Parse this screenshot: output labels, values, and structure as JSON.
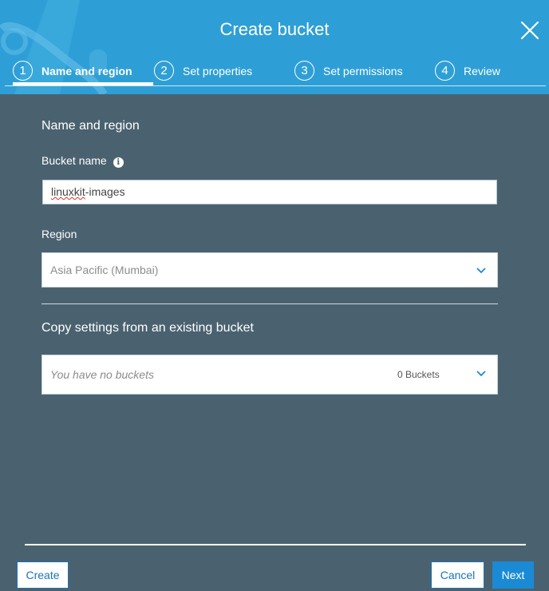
{
  "dialog": {
    "title": "Create bucket"
  },
  "steps": [
    {
      "number": "1",
      "label": "Name and region",
      "active": true
    },
    {
      "number": "2",
      "label": "Set properties",
      "active": false
    },
    {
      "number": "3",
      "label": "Set permissions",
      "active": false
    },
    {
      "number": "4",
      "label": "Review",
      "active": false
    }
  ],
  "form": {
    "section_title": "Name and region",
    "bucket_name_label": "Bucket name",
    "bucket_name_value_misspelled": "linuxkit",
    "bucket_name_value_rest": "-images",
    "region_label": "Region",
    "region_value": "Asia Pacific (Mumbai)",
    "copy_settings_title": "Copy settings from an existing bucket",
    "copy_settings_placeholder": "You have no buckets",
    "copy_settings_count": "0 Buckets"
  },
  "footer": {
    "create_label": "Create",
    "cancel_label": "Cancel",
    "next_label": "Next"
  },
  "colors": {
    "header_bg": "#2e9fd6",
    "body_bg": "#4a6270",
    "primary_button": "#1a8ad4",
    "link_blue": "#1a73b8"
  },
  "icons": {
    "close": "close-icon",
    "info": "info-icon",
    "dropdown": "chevron-down-icon"
  }
}
